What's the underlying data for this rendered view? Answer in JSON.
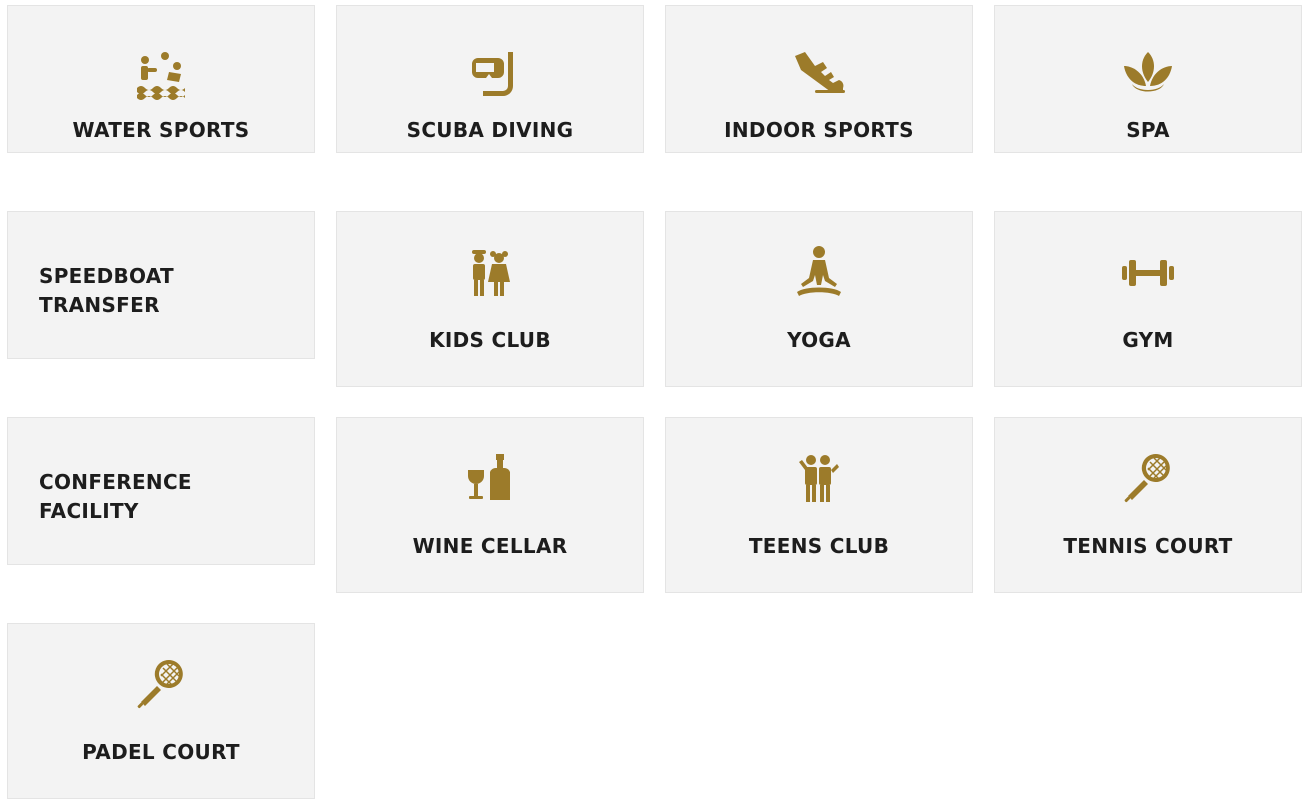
{
  "accent_color": "#9c7b2a",
  "tiles": [
    {
      "label": "WATER SPORTS",
      "icon": "water-sports-icon"
    },
    {
      "label": "SCUBA DIVING",
      "icon": "snorkel-mask-icon"
    },
    {
      "label": "INDOOR SPORTS",
      "icon": "sneaker-icon"
    },
    {
      "label": "SPA",
      "icon": "lotus-icon"
    },
    {
      "label": "SPEEDBOAT\nTRANSFER",
      "icon": ""
    },
    {
      "label": "KIDS CLUB",
      "icon": "kids-icon"
    },
    {
      "label": "YOGA",
      "icon": "meditation-icon"
    },
    {
      "label": "GYM",
      "icon": "dumbbell-icon"
    },
    {
      "label": "CONFERENCE\nFACILITY",
      "icon": ""
    },
    {
      "label": "WINE CELLAR",
      "icon": "wine-icon"
    },
    {
      "label": "TEENS CLUB",
      "icon": "teens-icon"
    },
    {
      "label": "TENNIS COURT",
      "icon": "tennis-racket-icon"
    },
    {
      "label": "PADEL COURT",
      "icon": "padel-racket-icon"
    }
  ]
}
